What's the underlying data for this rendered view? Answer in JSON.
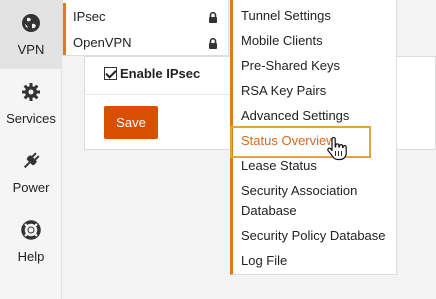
{
  "sidebar": {
    "items": [
      {
        "label": "VPN",
        "icon": "globe-icon",
        "active": true
      },
      {
        "label": "Services",
        "icon": "gear-icon",
        "active": false
      },
      {
        "label": "Power",
        "icon": "plug-icon",
        "active": false
      },
      {
        "label": "Help",
        "icon": "lifebuoy-icon",
        "active": false
      }
    ]
  },
  "vpn_menu": {
    "items": [
      {
        "label": "IPsec",
        "icon": "lock-icon",
        "active": true
      },
      {
        "label": "OpenVPN",
        "icon": "lock-icon",
        "active": false
      }
    ]
  },
  "ipsec_menu": {
    "items": [
      {
        "label": "Tunnel Settings"
      },
      {
        "label": "Mobile Clients"
      },
      {
        "label": "Pre-Shared Keys"
      },
      {
        "label": "RSA Key Pairs"
      },
      {
        "label": "Advanced Settings"
      },
      {
        "label": "Status Overview",
        "highlighted": true
      },
      {
        "label": "Lease Status"
      },
      {
        "label": "Security Association",
        "label2": "Database"
      },
      {
        "label": "Security Policy Database"
      },
      {
        "label": "Log File"
      }
    ]
  },
  "form": {
    "enable_label": "Enable IPsec",
    "enable_checked": true,
    "save_label": "Save"
  },
  "colors": {
    "accent": "#d94f00",
    "menu_accent": "#e07a1a",
    "highlight_border": "#e7a33a"
  }
}
